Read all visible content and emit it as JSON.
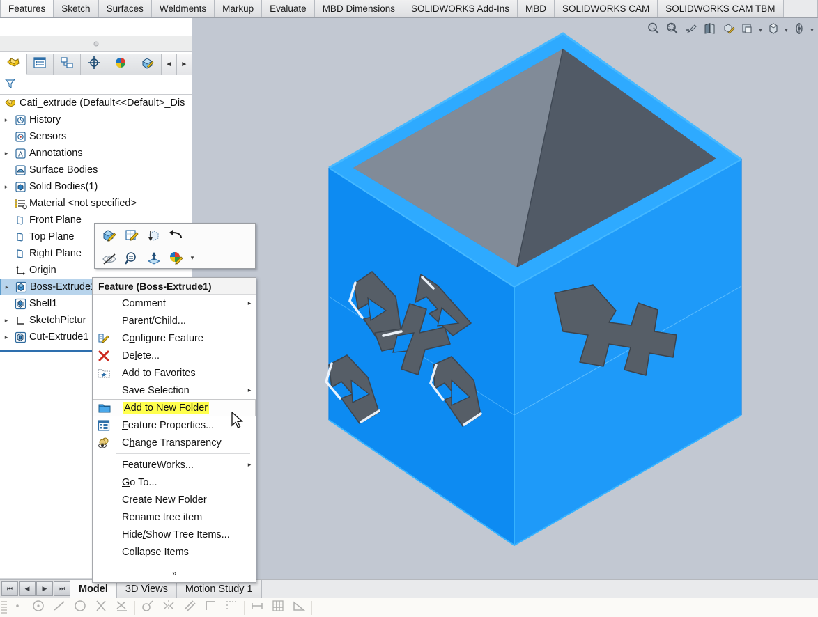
{
  "app": {
    "background_color": "#c2c8d2",
    "accent_color": "#0d8bf2"
  },
  "ribbon": {
    "tabs": [
      {
        "label": "Features",
        "active": true
      },
      {
        "label": "Sketch",
        "active": false
      },
      {
        "label": "Surfaces",
        "active": false
      },
      {
        "label": "Weldments",
        "active": false
      },
      {
        "label": "Markup",
        "active": false
      },
      {
        "label": "Evaluate",
        "active": false
      },
      {
        "label": "MBD Dimensions",
        "active": false
      },
      {
        "label": "SOLIDWORKS Add-Ins",
        "active": false
      },
      {
        "label": "MBD",
        "active": false
      },
      {
        "label": "SOLIDWORKS CAM",
        "active": false
      },
      {
        "label": "SOLIDWORKS CAM TBM",
        "active": false
      }
    ]
  },
  "feature_manager": {
    "tabs": [
      {
        "name": "feature-tree-tab",
        "icon": "feature-tree-icon",
        "active": true
      },
      {
        "name": "property-manager-tab",
        "icon": "property-manager-icon",
        "active": false
      },
      {
        "name": "configuration-manager-tab",
        "icon": "configuration-manager-icon",
        "active": false
      },
      {
        "name": "dimxpert-manager-tab",
        "icon": "dimxpert-icon",
        "active": false
      },
      {
        "name": "display-manager-tab",
        "icon": "display-manager-icon",
        "active": false
      },
      {
        "name": "cam-feature-tree-tab",
        "icon": "cam-tree-icon",
        "active": false
      }
    ],
    "scroll_left_label": "◄",
    "scroll_right_label": "►",
    "filter_placeholder": "",
    "filter_icon": "filter-funnel-icon",
    "tree": [
      {
        "label": "Cati_extrude  (Default<<Default>_Dis",
        "icon": "part-icon",
        "expander": "none",
        "indent": 0,
        "selected": false,
        "root": true
      },
      {
        "label": "History",
        "icon": "history-icon",
        "expander": "collapsed",
        "indent": 1,
        "selected": false
      },
      {
        "label": "Sensors",
        "icon": "sensors-icon",
        "expander": "none",
        "indent": 1,
        "selected": false
      },
      {
        "label": "Annotations",
        "icon": "annotations-icon",
        "expander": "collapsed",
        "indent": 1,
        "selected": false
      },
      {
        "label": "Surface Bodies",
        "icon": "surface-bodies-icon",
        "expander": "none",
        "indent": 1,
        "selected": false
      },
      {
        "label": "Solid Bodies(1)",
        "icon": "solid-bodies-icon",
        "expander": "collapsed",
        "indent": 1,
        "selected": false
      },
      {
        "label": "Material <not specified>",
        "icon": "material-icon",
        "expander": "none",
        "indent": 1,
        "selected": false
      },
      {
        "label": "Front Plane",
        "icon": "plane-icon",
        "expander": "none",
        "indent": 1,
        "selected": false
      },
      {
        "label": "Top Plane",
        "icon": "plane-icon",
        "expander": "none",
        "indent": 1,
        "selected": false
      },
      {
        "label": "Right Plane",
        "icon": "plane-icon",
        "expander": "none",
        "indent": 1,
        "selected": false
      },
      {
        "label": "Origin",
        "icon": "origin-icon",
        "expander": "none",
        "indent": 1,
        "selected": false
      },
      {
        "label": "Boss-Extrude1",
        "icon": "boss-extrude-icon",
        "expander": "collapsed",
        "indent": 1,
        "selected": true
      },
      {
        "label": "Shell1",
        "icon": "shell-icon",
        "expander": "none",
        "indent": 1,
        "selected": false
      },
      {
        "label": "SketchPictur",
        "icon": "sketch-picture-icon",
        "expander": "collapsed",
        "indent": 1,
        "selected": false
      },
      {
        "label": "Cut-Extrude1",
        "icon": "cut-extrude-icon",
        "expander": "collapsed",
        "indent": 1,
        "selected": false
      }
    ],
    "hscroll": {
      "left_arrow": "‹",
      "right_arrow": "›"
    }
  },
  "context_toolbar": {
    "row1": [
      {
        "name": "edit-feature-button",
        "icon": "edit-feature-icon"
      },
      {
        "name": "edit-sketch-button",
        "icon": "edit-sketch-icon"
      },
      {
        "name": "rollback-button",
        "icon": "rollback-icon"
      },
      {
        "name": "suppress-button",
        "icon": "suppress-arrow-icon"
      }
    ],
    "row2": [
      {
        "name": "hide-button",
        "icon": "hide-eye-icon"
      },
      {
        "name": "zoom-to-selection-button",
        "icon": "zoom-selection-icon"
      },
      {
        "name": "normal-to-button",
        "icon": "normal-to-icon"
      },
      {
        "name": "appearances-button",
        "icon": "appearance-sphere-icon"
      }
    ],
    "dropdown_caret": "▾"
  },
  "context_menu": {
    "title": "Feature (Boss-Extrude1)",
    "items": [
      {
        "label": "Comment",
        "icon": null,
        "submenu": true,
        "highlight": false,
        "accel": null
      },
      {
        "label": "Parent/Child...",
        "icon": null,
        "submenu": false,
        "highlight": false,
        "accel": "P"
      },
      {
        "label": "Configure Feature",
        "icon": "configure-feature-icon",
        "submenu": false,
        "highlight": false,
        "accel": "o"
      },
      {
        "label": "Delete...",
        "icon": "delete-x-icon",
        "submenu": false,
        "highlight": false,
        "accel": "l"
      },
      {
        "label": "Add to Favorites",
        "icon": "favorites-star-folder-icon",
        "submenu": false,
        "highlight": false,
        "accel": "A"
      },
      {
        "label": "Save Selection",
        "icon": null,
        "submenu": true,
        "highlight": false,
        "accel": null
      },
      {
        "label": "Add to New Folder",
        "icon": "new-folder-icon",
        "submenu": false,
        "highlight": true,
        "accel": "t"
      },
      {
        "label": "Feature Properties...",
        "icon": "feature-properties-icon",
        "submenu": false,
        "highlight": false,
        "accel": "F"
      },
      {
        "label": "Change Transparency",
        "icon": "change-transparency-icon",
        "submenu": false,
        "highlight": false,
        "accel": "h"
      },
      {
        "separator": true
      },
      {
        "label": "FeatureWorks...",
        "icon": null,
        "submenu": true,
        "highlight": false,
        "accel": "W"
      },
      {
        "label": "Go To...",
        "icon": null,
        "submenu": false,
        "highlight": false,
        "accel": "G"
      },
      {
        "label": "Create New Folder",
        "icon": null,
        "submenu": false,
        "highlight": false,
        "accel": null
      },
      {
        "label": "Rename tree item",
        "icon": null,
        "submenu": false,
        "highlight": false,
        "accel": null
      },
      {
        "label": "Hide/Show Tree Items...",
        "icon": null,
        "submenu": false,
        "highlight": false,
        "accel": "/"
      },
      {
        "label": "Collapse Items",
        "icon": null,
        "submenu": false,
        "highlight": false,
        "accel": null
      },
      {
        "separator": true
      }
    ],
    "expand_label": "»"
  },
  "view_toolbar": {
    "buttons": [
      {
        "name": "zoom-to-fit-button",
        "icon": "zoom-fit-icon",
        "caret": false
      },
      {
        "name": "zoom-to-area-button",
        "icon": "zoom-area-icon",
        "caret": false
      },
      {
        "name": "previous-view-button",
        "icon": "previous-view-icon",
        "caret": false
      },
      {
        "name": "section-view-button",
        "icon": "section-view-icon",
        "caret": false
      },
      {
        "name": "view-orientation-button",
        "icon": "view-orientation-icon",
        "caret": false
      },
      {
        "name": "display-style-button",
        "icon": "display-style-icon",
        "caret": true
      },
      {
        "name": "hide-show-items-button",
        "icon": "hide-show-items-icon",
        "caret": true
      },
      {
        "name": "apply-scene-button",
        "icon": "apply-scene-icon",
        "caret": true
      }
    ]
  },
  "model": {
    "body_color": "#0d8bf2",
    "body_highlight_color": "#2ba9ff",
    "interior_color_light": "#7d8694",
    "interior_color_dark": "#4f5864",
    "cut_face_color": "#565e67",
    "description": "Isometric open-top shelled box with decorative cut-extrude pattern on the front-left face"
  },
  "bottom_bar": {
    "nav_buttons": [
      {
        "name": "first-tab-button",
        "glyph": "⏮"
      },
      {
        "name": "previous-tab-button",
        "glyph": "◀"
      },
      {
        "name": "next-tab-button",
        "glyph": "▶"
      },
      {
        "name": "last-tab-button",
        "glyph": "⏭"
      }
    ],
    "tabs": [
      {
        "label": "Model",
        "active": true
      },
      {
        "label": "3D Views",
        "active": false
      },
      {
        "label": "Motion Study 1",
        "active": false
      }
    ]
  },
  "sketch_toolbar": {
    "groups": [
      [
        {
          "name": "point-tool",
          "icon": "point-icon"
        },
        {
          "name": "circle-tool",
          "icon": "circle-icon"
        },
        {
          "name": "line-tool",
          "icon": "line-icon"
        },
        {
          "name": "ellipse-tool",
          "icon": "ellipse-icon"
        },
        {
          "name": "trim-entities-tool",
          "icon": "trim-icon"
        },
        {
          "name": "extend-entities-tool",
          "icon": "extend-icon"
        }
      ],
      [
        {
          "name": "arc-tool",
          "icon": "arc-icon"
        },
        {
          "name": "mirror-entities-tool",
          "icon": "mirror-icon"
        },
        {
          "name": "offset-entities-tool",
          "icon": "offset-icon"
        },
        {
          "name": "corner-rectangle-tool",
          "icon": "rectangle-icon"
        },
        {
          "name": "linear-pattern-tool",
          "icon": "linear-pattern-icon"
        }
      ],
      [
        {
          "name": "smart-dimension-tool",
          "icon": "smart-dimension-icon"
        },
        {
          "name": "grid-settings-tool",
          "icon": "grid-icon"
        },
        {
          "name": "angle-dimension-tool",
          "icon": "angle-icon"
        }
      ]
    ]
  }
}
